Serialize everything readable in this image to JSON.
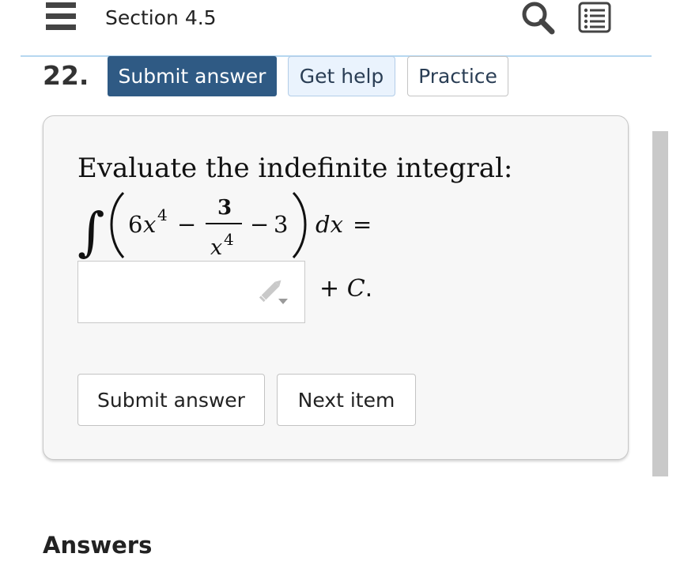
{
  "header": {
    "section_title": "Section 4.5",
    "menu_icon": "hamburger-menu-icon",
    "search_icon": "search-icon",
    "list_icon": "list-view-icon"
  },
  "question": {
    "number": "22.",
    "submit_label": "Submit answer",
    "help_label": "Get help",
    "practice_label": "Practice"
  },
  "card": {
    "prompt": "Evaluate the indefinite integral:",
    "math": {
      "integral_sign": "∫",
      "term1_coef": "6",
      "term1_var": "x",
      "term1_exp": "4",
      "minus1": "−",
      "frac_num": "3",
      "frac_den_var": "x",
      "frac_den_exp": "4",
      "minus2": "−",
      "const": "3",
      "dx": "dx",
      "equals": "="
    },
    "answer_value": "",
    "editor_icon": "pencil-icon",
    "plus": "+",
    "c_label": "C",
    "period": ".",
    "submit_label": "Submit answer",
    "next_label": "Next item"
  },
  "answers_heading": "Answers",
  "colors": {
    "primary": "#2f5a84",
    "help_bg": "#eaf3fd",
    "rule": "#b6d7f0",
    "card_bg": "#f7f7f7"
  }
}
